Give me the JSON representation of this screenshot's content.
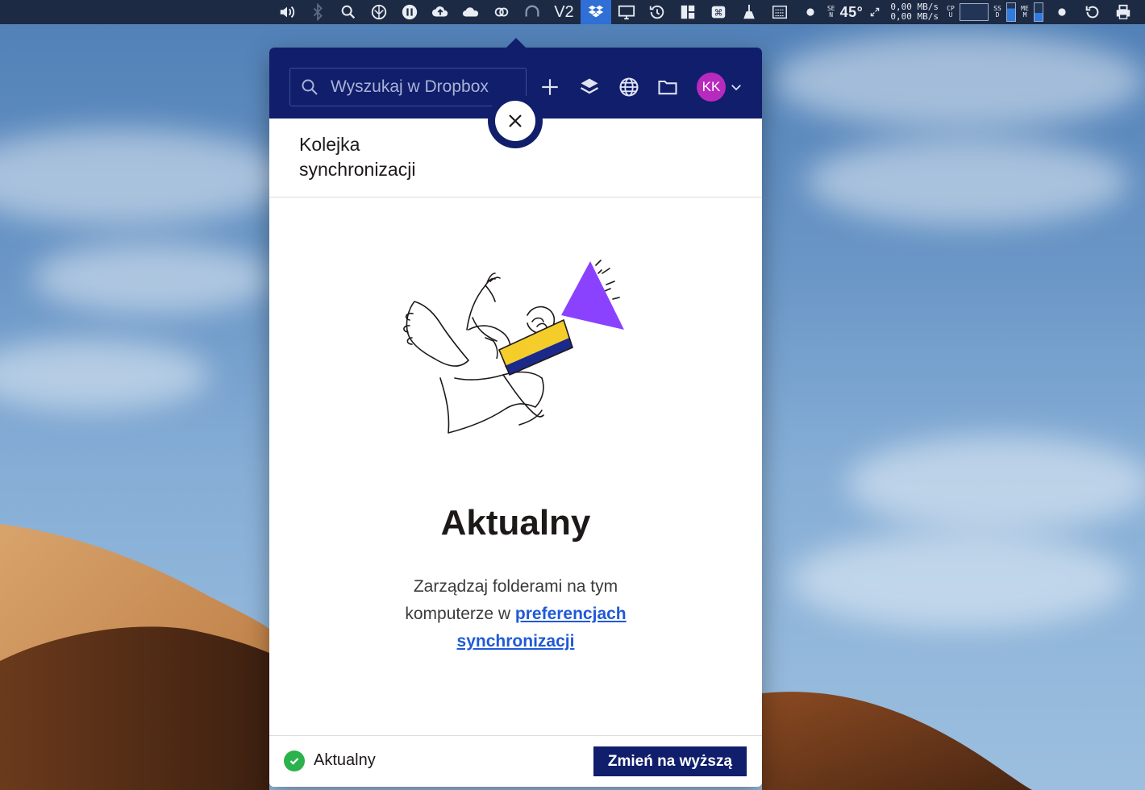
{
  "menubar": {
    "temperature": "45°",
    "net_up": "0,00 MB/s",
    "net_down": "0,00 MB/s",
    "sen_label": "SEN",
    "cpu_label": "CPU",
    "ssd_label": "SSD",
    "mem_label": "MEM",
    "v2_label": "V2"
  },
  "popup": {
    "search_placeholder": "Wyszukaj w Dropbox",
    "avatar_initials": "KK",
    "header_title": "Kolejka synchronizacji",
    "main_title": "Aktualny",
    "desc_text": "Zarządzaj folderami na tym komputerze w ",
    "desc_link": "preferencjach synchronizacji",
    "status_text": "Aktualny",
    "upgrade_label": "Zmień na wyższą"
  },
  "colors": {
    "toolbar_bg": "#101e6b",
    "accent_purple": "#8a42ff",
    "status_green": "#2bb24c",
    "link_blue": "#1f5ad6"
  }
}
